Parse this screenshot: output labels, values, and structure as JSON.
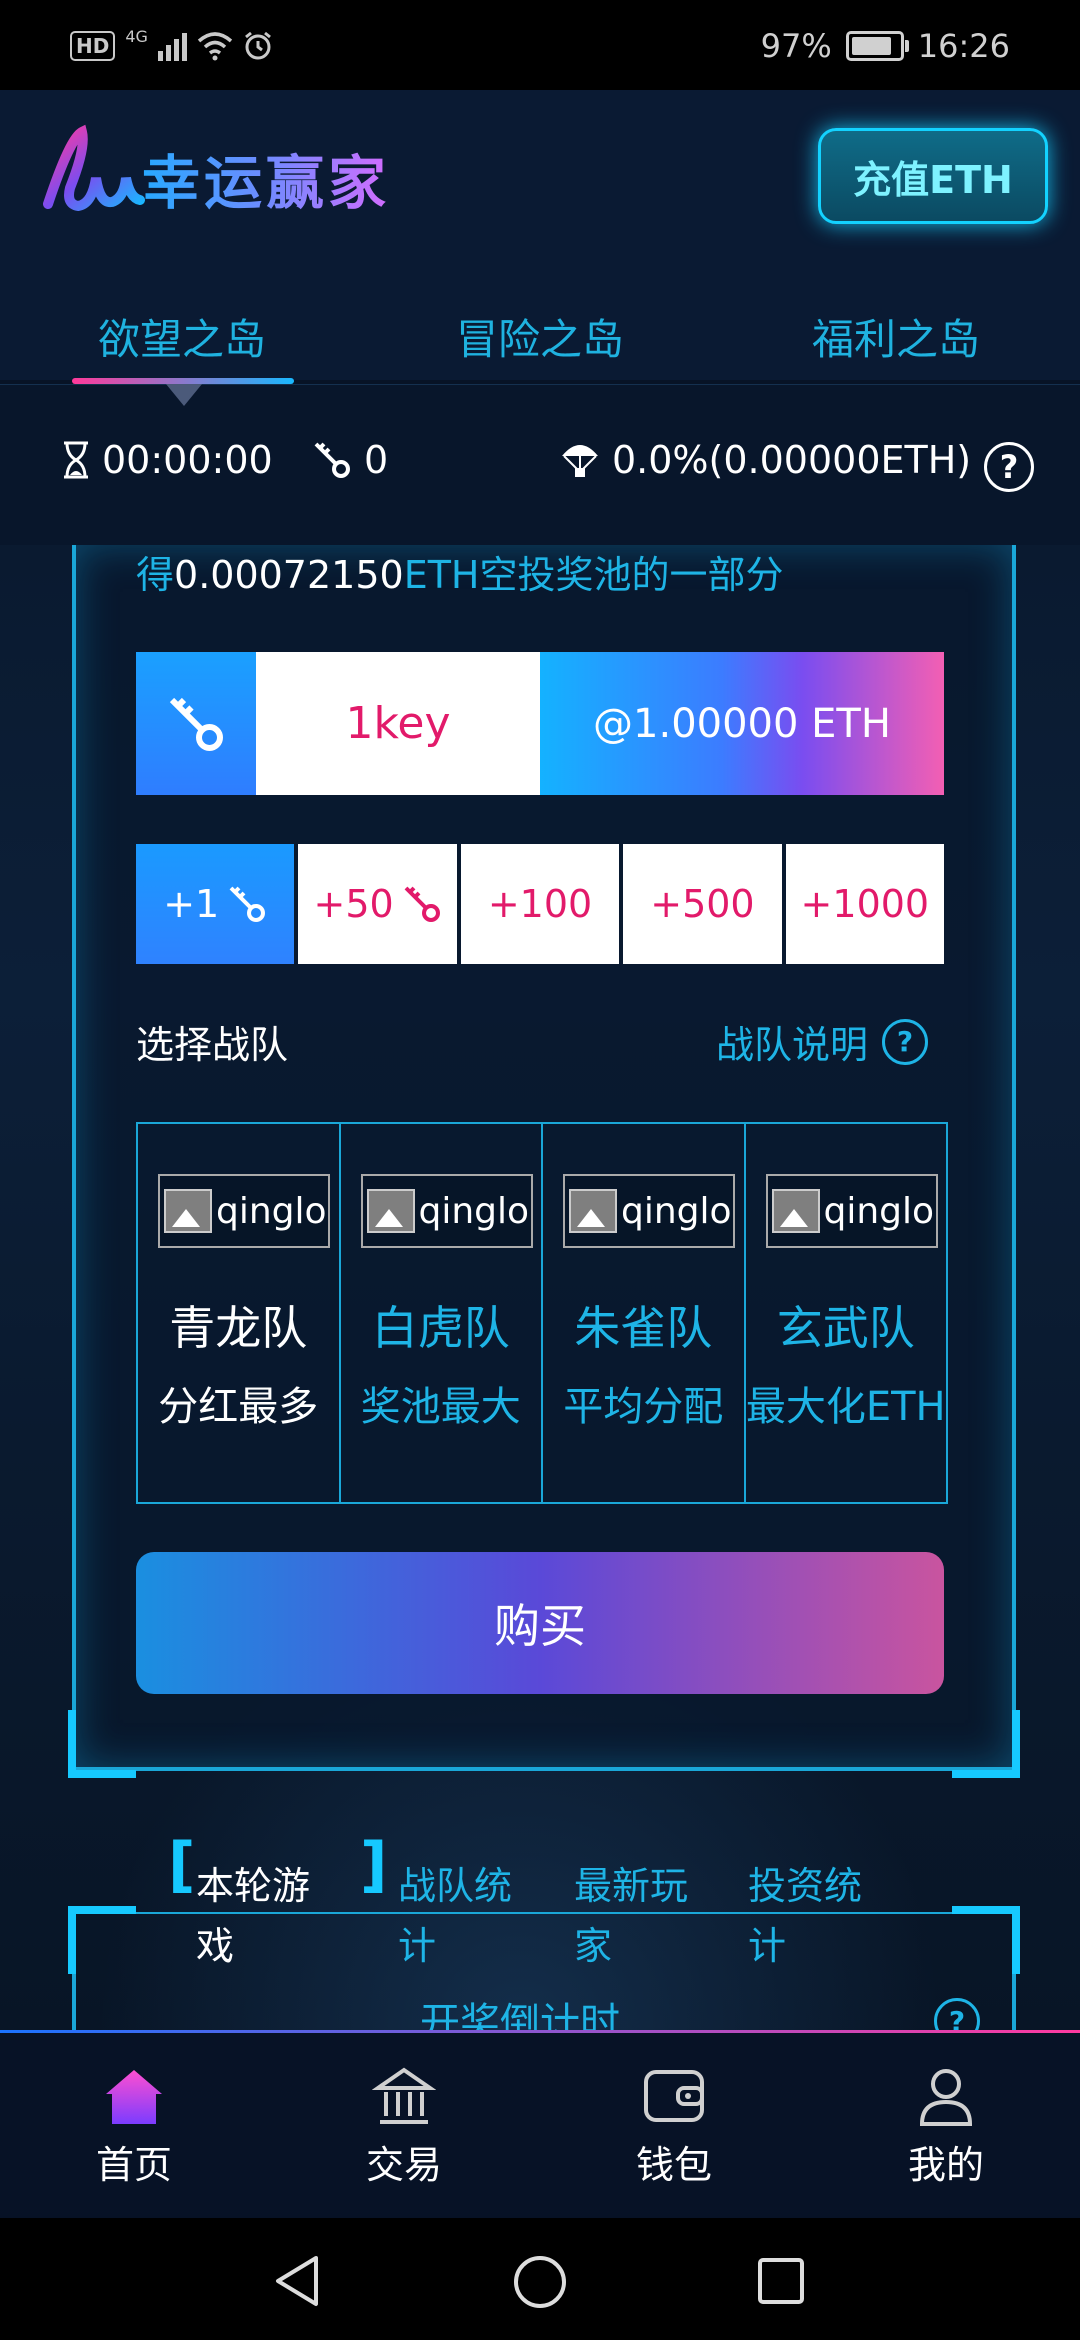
{
  "status_bar": {
    "network": "4G",
    "hd": "HD",
    "battery_percent": "97%",
    "battery_level": 0.97,
    "time": "16:26"
  },
  "header": {
    "title": "幸运赢家",
    "recharge_label": "充值ETH"
  },
  "tabs": [
    {
      "label": "欲望之岛",
      "active": true
    },
    {
      "label": "冒险之岛",
      "active": false
    },
    {
      "label": "福利之岛",
      "active": false
    }
  ],
  "info_bar": {
    "timer": "00:00:00",
    "keys": "0",
    "airdrop": "0.0%(0.00000ETH)"
  },
  "main": {
    "airdrop_prefix": "得",
    "airdrop_amount": "0.00072150",
    "airdrop_suffix": "ETH空投奖池的一部分",
    "key_qty": "1key",
    "key_price": "@1.00000 ETH",
    "qty_buttons": [
      "+1",
      "+50",
      "+100",
      "+500",
      "+1000"
    ],
    "team_label": "选择战队",
    "team_help": "战队说明",
    "teams": [
      {
        "img_alt": "qinglong",
        "name": "青龙队",
        "desc": "分红最多"
      },
      {
        "img_alt": "qinglong",
        "name": "白虎队",
        "desc": "奖池最大"
      },
      {
        "img_alt": "qinglong",
        "name": "朱雀队",
        "desc": "平均分配"
      },
      {
        "img_alt": "qinglong",
        "name": "玄武队",
        "desc": "最大化ETH"
      }
    ],
    "buy_label": "购买"
  },
  "stats_tabs": [
    "本轮游戏",
    "战队统计",
    "最新玩家",
    "投资统计"
  ],
  "countdown_title": "开奖倒计时",
  "bottom_nav": [
    {
      "label": "首页",
      "icon": "home-icon",
      "active": true
    },
    {
      "label": "交易",
      "icon": "bank-icon",
      "active": false
    },
    {
      "label": "钱包",
      "icon": "wallet-icon",
      "active": false
    },
    {
      "label": "我的",
      "icon": "user-icon",
      "active": false
    }
  ],
  "colors": {
    "accent": "#1eb4e6",
    "pink": "#e21a6a",
    "background": "#071326"
  }
}
